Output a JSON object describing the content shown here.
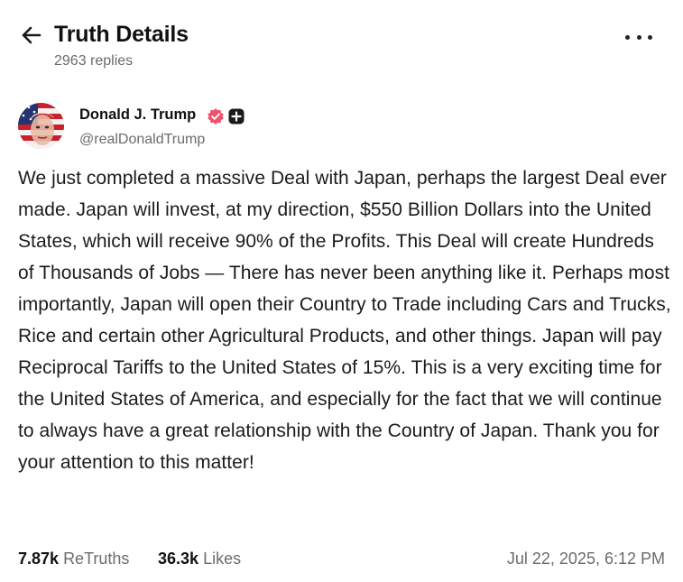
{
  "header": {
    "title": "Truth Details",
    "reply_count": "2963 replies",
    "back_icon": "arrow-left-icon",
    "more_icon": "ellipsis-icon"
  },
  "post": {
    "author": {
      "name": "Donald J. Trump",
      "handle": "@realDonaldTrump",
      "verified_color": "#f0516b"
    },
    "text": "We just completed a massive Deal with Japan, perhaps the largest Deal ever made. Japan will invest, at my direction, $550 Billion Dollars into the United States, which will receive 90% of the Profits. This Deal will create Hundreds of Thousands of Jobs — There has never been anything like it. Perhaps most importantly, Japan will open their Country to Trade including Cars and Trucks, Rice and certain other Agricultural Products, and other things. Japan will pay Reciprocal Tariffs to the United States of 15%. This is a very exciting time for the United States of America, and especially for the fact that we will continue to always have a great relationship with the Country of Japan. Thank you for your attention to this matter!",
    "stats": {
      "retruths_count": "7.87k",
      "retruths_label": "ReTruths",
      "likes_count": "36.3k",
      "likes_label": "Likes"
    },
    "timestamp": "Jul 22, 2025, 6:12 PM"
  }
}
